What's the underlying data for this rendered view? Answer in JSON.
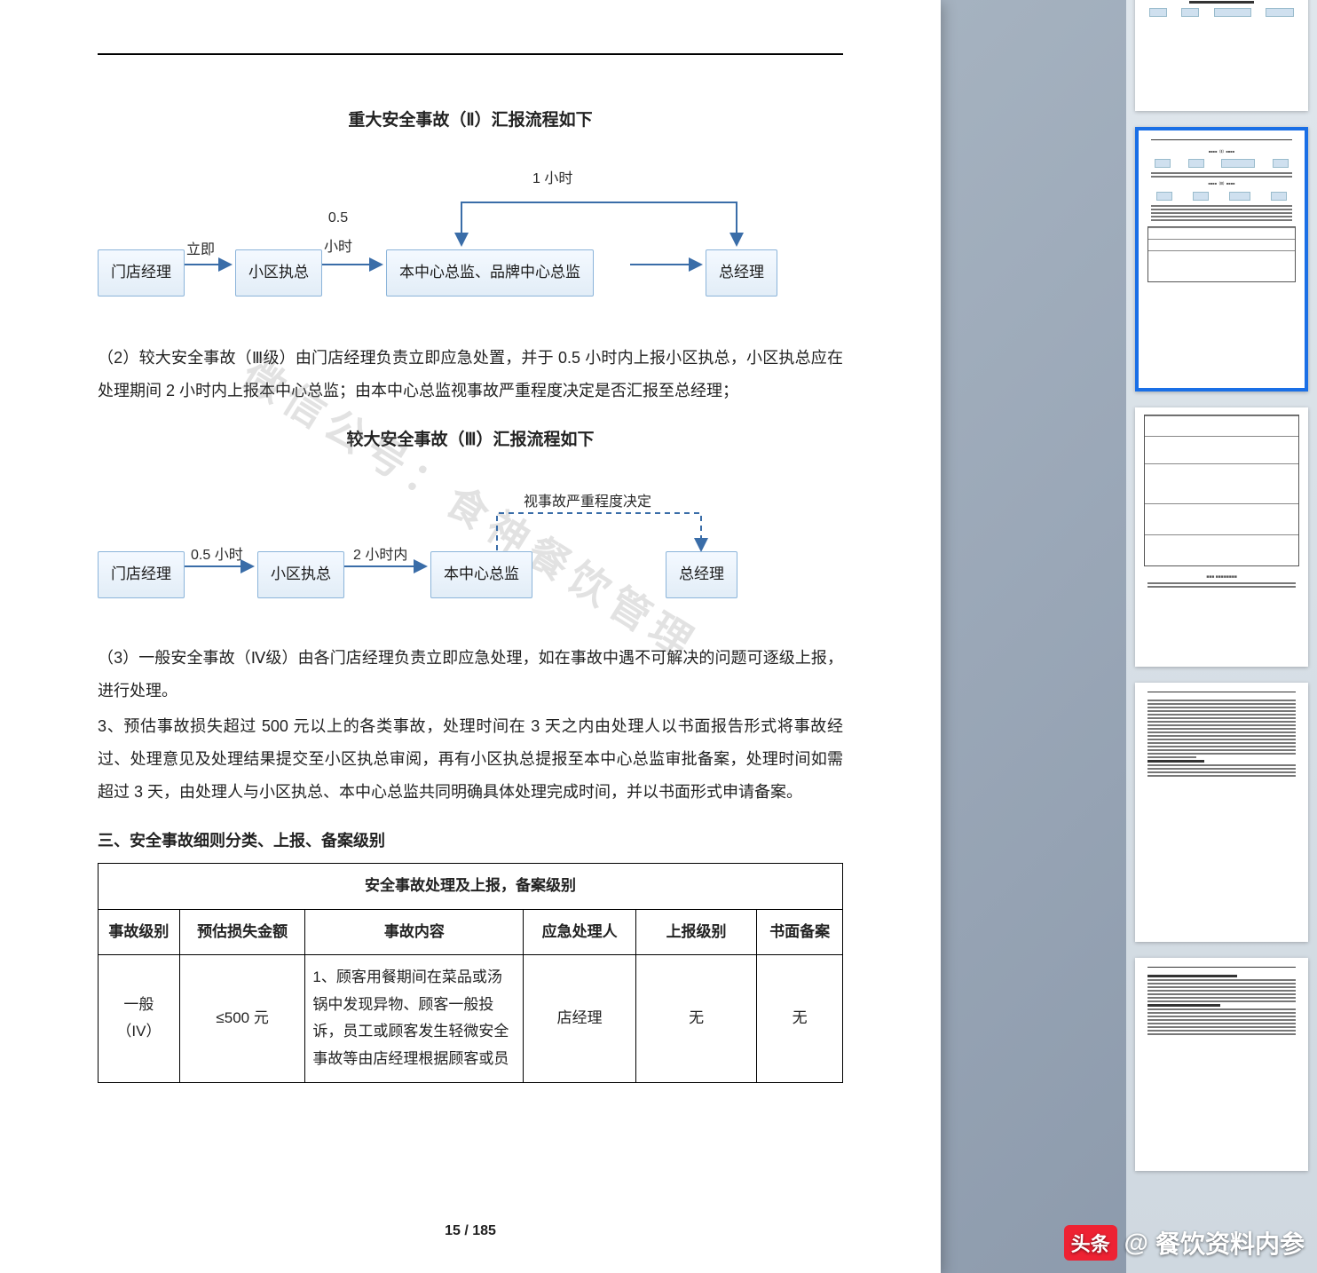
{
  "page": {
    "watermark": "微信公号：食神餐饮管理",
    "title1": "重大安全事故（Ⅱ）汇报流程如下",
    "flow1": {
      "n1": "门店经理",
      "n2": "小区执总",
      "n3": "本中心总监、品牌中心总监",
      "n4": "总经理",
      "t_immediate": "立即",
      "t_half_hour": "0.5\n小时",
      "t_one_hour": "1 小时"
    },
    "para2": "（2）较大安全事故（Ⅲ级）由门店经理负责立即应急处置，并于 0.5 小时内上报小区执总，小区执总应在处理期间 2 小时内上报本中心总监；由本中心总监视事故严重程度决定是否汇报至总经理；",
    "title2": "较大安全事故（Ⅲ）汇报流程如下",
    "flow2": {
      "n1": "门店经理",
      "n2": "小区执总",
      "n3": "本中心总监",
      "n4": "总经理",
      "t_half": "0.5 小时",
      "t_two": "2 小时内",
      "t_decide": "视事故严重程度决定"
    },
    "para3": "（3）一般安全事故（Ⅳ级）由各门店经理负责立即应急处理，如在事故中遇不可解决的问题可逐级上报，进行处理。",
    "para4": "3、预估事故损失超过 500 元以上的各类事故，处理时间在 3 天之内由处理人以书面报告形式将事故经过、处理意见及处理结果提交至小区执总审阅，再有小区执总提报至本中心总监审批备案，处理时间如需超过 3 天，由处理人与小区执总、本中心总监共同明确具体处理完成时间，并以书面形式申请备案。",
    "section3_heading": "三、安全事故细则分类、上报、备案级别",
    "table": {
      "caption": "安全事故处理及上报，备案级别",
      "headers": [
        "事故级别",
        "预估损失金额",
        "事故内容",
        "应急处理人",
        "上报级别",
        "书面备案"
      ],
      "row1": {
        "level": "一般（IV）",
        "loss": "≤500 元",
        "content": "1、顾客用餐期间在菜品或汤锅中发现异物、顾客一般投诉，员工或顾客发生轻微安全事故等由店经理根据顾客或员",
        "handler": "店经理",
        "report": "无",
        "file": "无"
      }
    },
    "page_number": "15 / 185"
  },
  "thumbs": {
    "items": [
      {
        "selected": false
      },
      {
        "selected": true
      },
      {
        "selected": false
      },
      {
        "selected": false
      },
      {
        "selected": false
      }
    ]
  },
  "brand": {
    "logo": "头条",
    "at": "@",
    "name": "餐饮资料内参"
  }
}
